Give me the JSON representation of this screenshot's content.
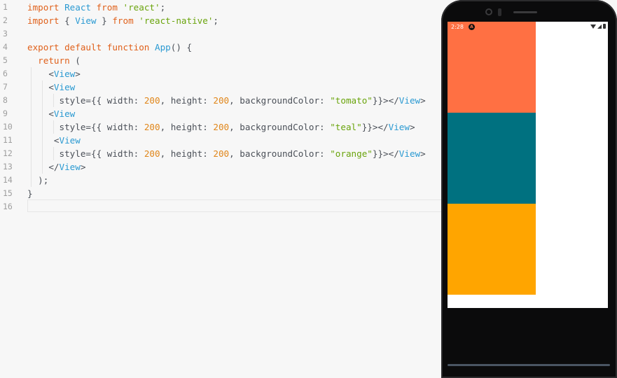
{
  "editor": {
    "lines": [
      {
        "n": "1",
        "tokens": [
          [
            "kw",
            "import "
          ],
          [
            "id",
            "React "
          ],
          [
            "kw",
            "from "
          ],
          [
            "str",
            "'react'"
          ],
          [
            "pn",
            ";"
          ]
        ]
      },
      {
        "n": "2",
        "tokens": [
          [
            "kw",
            "import "
          ],
          [
            "pn",
            "{ "
          ],
          [
            "id",
            "View"
          ],
          [
            "pn",
            " } "
          ],
          [
            "kw",
            "from "
          ],
          [
            "str",
            "'react-native'"
          ],
          [
            "pn",
            ";"
          ]
        ]
      },
      {
        "n": "3",
        "tokens": []
      },
      {
        "n": "4",
        "tokens": [
          [
            "kw",
            "export default function "
          ],
          [
            "id",
            "App"
          ],
          [
            "pn",
            "() {"
          ]
        ]
      },
      {
        "n": "5",
        "tokens": [
          [
            "pn",
            "  "
          ],
          [
            "kw",
            "return "
          ],
          [
            "pn",
            "("
          ]
        ]
      },
      {
        "n": "6",
        "tokens": [
          [
            "pn",
            "    <"
          ],
          [
            "id",
            "View"
          ],
          [
            "pn",
            ">"
          ]
        ]
      },
      {
        "n": "7",
        "tokens": [
          [
            "pn",
            "    <"
          ],
          [
            "id",
            "View"
          ]
        ]
      },
      {
        "n": "8",
        "tokens": [
          [
            "pn",
            "      style={{ width: "
          ],
          [
            "num",
            "200"
          ],
          [
            "pn",
            ", height: "
          ],
          [
            "num",
            "200"
          ],
          [
            "pn",
            ", backgroundColor: "
          ],
          [
            "str",
            "\"tomato\""
          ],
          [
            "pn",
            "}}></"
          ],
          [
            "id",
            "View"
          ],
          [
            "pn",
            ">"
          ]
        ]
      },
      {
        "n": "9",
        "tokens": [
          [
            "pn",
            "    <"
          ],
          [
            "id",
            "View"
          ]
        ]
      },
      {
        "n": "10",
        "tokens": [
          [
            "pn",
            "      style={{ width: "
          ],
          [
            "num",
            "200"
          ],
          [
            "pn",
            ", height: "
          ],
          [
            "num",
            "200"
          ],
          [
            "pn",
            ", backgroundColor: "
          ],
          [
            "str",
            "\"teal\""
          ],
          [
            "pn",
            "}}></"
          ],
          [
            "id",
            "View"
          ],
          [
            "pn",
            ">"
          ]
        ]
      },
      {
        "n": "11",
        "tokens": [
          [
            "pn",
            "     <"
          ],
          [
            "id",
            "View"
          ]
        ]
      },
      {
        "n": "12",
        "tokens": [
          [
            "pn",
            "      style={{ width: "
          ],
          [
            "num",
            "200"
          ],
          [
            "pn",
            ", height: "
          ],
          [
            "num",
            "200"
          ],
          [
            "pn",
            ", backgroundColor: "
          ],
          [
            "str",
            "\"orange\""
          ],
          [
            "pn",
            "}}></"
          ],
          [
            "id",
            "View"
          ],
          [
            "pn",
            ">"
          ]
        ]
      },
      {
        "n": "13",
        "tokens": [
          [
            "pn",
            "    </"
          ],
          [
            "id",
            "View"
          ],
          [
            "pn",
            ">"
          ]
        ]
      },
      {
        "n": "14",
        "tokens": [
          [
            "pn",
            "  );"
          ]
        ]
      },
      {
        "n": "15",
        "tokens": [
          [
            "pn",
            "}"
          ]
        ]
      },
      {
        "n": "16",
        "tokens": []
      }
    ]
  },
  "phone": {
    "status_time": "2:28",
    "status_app_icon": "A",
    "boxes": [
      {
        "name": "tomato-box",
        "color": "#ff7043"
      },
      {
        "name": "teal-box",
        "color": "#007180"
      },
      {
        "name": "orange-box",
        "color": "#ffa500"
      }
    ]
  },
  "colors": {
    "keyword": "#e0601a",
    "identifier": "#2b9ad2",
    "string": "#6aa40c",
    "number": "#e0861a",
    "editor_bg": "#f7f7f7",
    "phone_frame": "#0b0b0c"
  }
}
